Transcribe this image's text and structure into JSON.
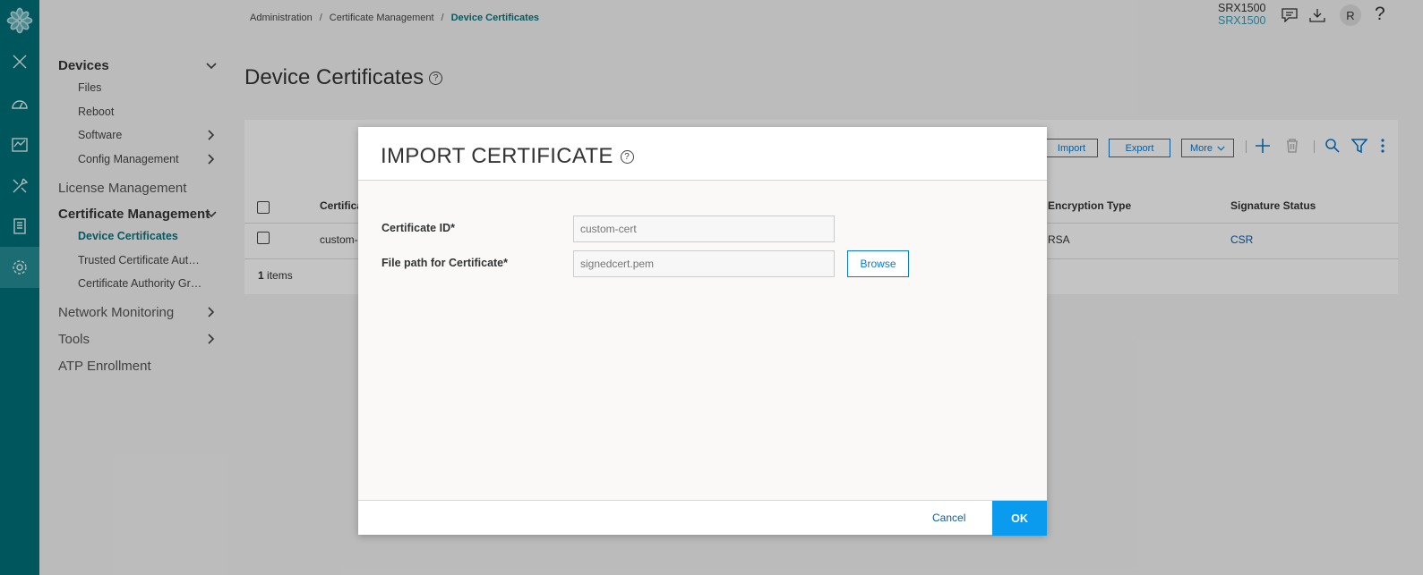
{
  "breadcrumb": {
    "items": [
      "Administration",
      "Certificate Management",
      "Device Certificates"
    ]
  },
  "page": {
    "title": "Device Certificates"
  },
  "header": {
    "device_line1": "SRX1500",
    "device_line2": "SRX1500",
    "avatar_initial": "R",
    "help": "?"
  },
  "sidebar": {
    "sections": [
      {
        "label": "Devices"
      },
      {
        "label": "License Management"
      },
      {
        "label": "Certificate Management"
      },
      {
        "label": "Network Monitoring"
      },
      {
        "label": "Tools"
      },
      {
        "label": "ATP Enrollment"
      }
    ],
    "devices_items": [
      "Files",
      "Reboot",
      "Software",
      "Config Management"
    ],
    "cert_items": [
      "Device Certificates",
      "Trusted Certificate Auth…",
      "Certificate Authority Gr…"
    ]
  },
  "toolbar": {
    "import": "Import",
    "export": "Export",
    "more": "More"
  },
  "table": {
    "headers": {
      "col1": "Certifica",
      "encryption": "Encryption Type",
      "signature": "Signature Status"
    },
    "row": {
      "col1": "custom-",
      "encryption": "RSA",
      "signature": "CSR"
    },
    "items_count": "1",
    "items_label": "items"
  },
  "modal": {
    "title": "IMPORT CERTIFICATE",
    "fields": {
      "cert_id_label": "Certificate ID*",
      "cert_id_value": "custom-cert",
      "file_path_label": "File path for Certificate*",
      "file_path_value": "signedcert.pem"
    },
    "browse": "Browse",
    "cancel": "Cancel",
    "ok": "OK"
  },
  "colors": {
    "rail": "#00707a",
    "accent": "#067782",
    "primary": "#0a9bef",
    "link": "#0a5ca8"
  }
}
